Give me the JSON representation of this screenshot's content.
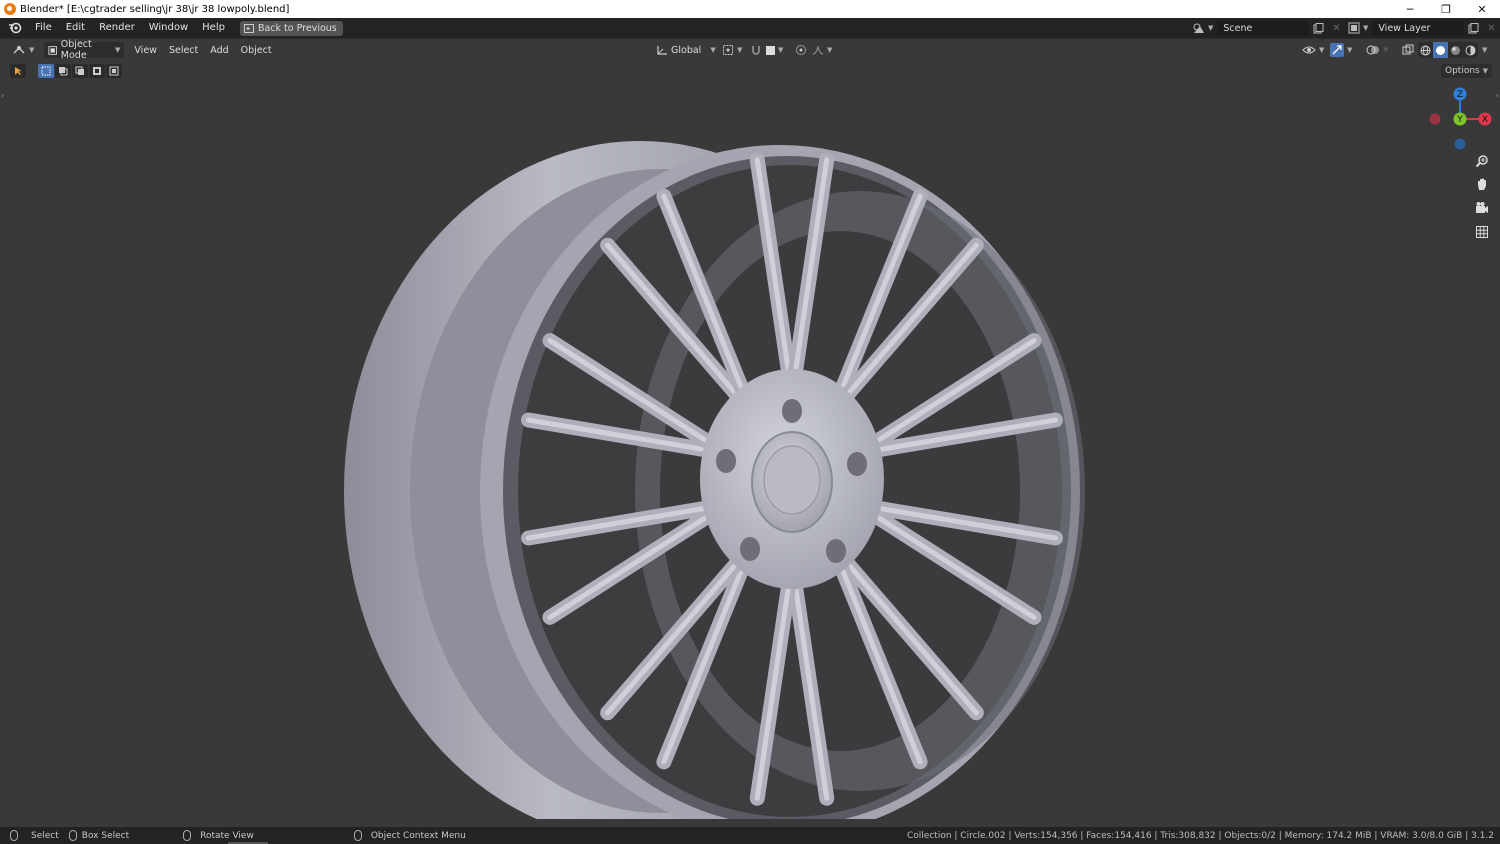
{
  "window": {
    "title": "Blender* [E:\\cgtrader selling\\jr 38\\jr 38 lowpoly.blend]",
    "controls": [
      "─",
      "❐",
      "✕"
    ]
  },
  "topbar": {
    "menus": [
      "File",
      "Edit",
      "Render",
      "Window",
      "Help"
    ],
    "back_button": "Back to Previous",
    "scene": "Scene",
    "view_layer": "View Layer"
  },
  "viewport_header": {
    "mode": "Object Mode",
    "menus": [
      "View",
      "Select",
      "Add",
      "Object"
    ],
    "transform_orientation": "Global",
    "options": "Options"
  },
  "gizmo": {
    "z": "Z",
    "y": "Y",
    "x": "X",
    "colors": {
      "x": "#e0384b",
      "y": "#7ec627",
      "z": "#2f7fd8"
    }
  },
  "statusbar": {
    "select": "Select",
    "box_select": "Box Select",
    "rotate_view": "Rotate View",
    "context_menu": "Object Context Menu",
    "stats": "Collection | Circle.002 | Verts:154,356 | Faces:154,416 | Tris:308,832 | Objects:0/2 | Memory: 174.2 MiB | VRAM: 3.0/8.0 GiB | 3.1.2"
  },
  "icons": [
    "blender-logo-icon",
    "editor-type-icon",
    "object-mode-icon",
    "transform-orientation-icon",
    "pivot-icon",
    "snap-icon",
    "proportional-edit-icon",
    "visibility-icon",
    "gizmo-icon",
    "overlay-icon",
    "xray-icon",
    "wireframe-shading-icon",
    "solid-shading-icon",
    "material-shading-icon",
    "rendered-shading-icon",
    "zoom-icon",
    "pan-hand-icon",
    "camera-icon",
    "ortho-grid-icon"
  ]
}
